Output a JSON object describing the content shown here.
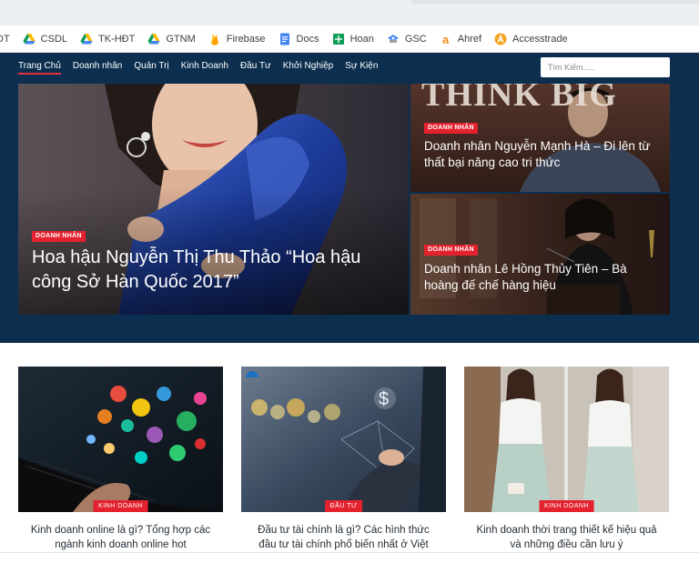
{
  "bookmarks": [
    {
      "label": "DT",
      "icon": "bookmark-icon"
    },
    {
      "label": "CSDL",
      "icon": "google-drive-icon"
    },
    {
      "label": "TK-HĐT",
      "icon": "google-drive-icon"
    },
    {
      "label": "GTNM",
      "icon": "google-drive-icon"
    },
    {
      "label": "Firebase",
      "icon": "firebase-icon"
    },
    {
      "label": "Docs",
      "icon": "google-docs-icon"
    },
    {
      "label": "Hoan",
      "icon": "google-sheets-icon"
    },
    {
      "label": "GSC",
      "icon": "search-console-icon"
    },
    {
      "label": "Ahref",
      "icon": "ahrefs-icon"
    },
    {
      "label": "Accesstrade",
      "icon": "accesstrade-icon"
    }
  ],
  "nav": {
    "items": [
      "Trang Chủ",
      "Doanh nhân",
      "Quản Trị",
      "Kinh Doanh",
      "Đầu Tư",
      "Khởi Nghiệp",
      "Sự Kiện"
    ],
    "search_placeholder": "Tìm Kiếm....."
  },
  "featured": {
    "main": {
      "badge": "DOANH NHÂN",
      "title": "Hoa hậu Nguyễn Thị Thu Thảo “Hoa hậu công Sở Hàn Quốc 2017”"
    },
    "side1": {
      "badge": "DOANH NHÂN",
      "title": "Doanh nhân Nguyễn Mạnh Hà – Đi lên từ thất bại nâng cao tri thức",
      "image_text": "THINK BIG"
    },
    "side2": {
      "badge": "DOANH NHÂN",
      "title": "Doanh nhân Lê Hồng Thủy Tiên – Bà hoàng đế chế hàng hiệu"
    }
  },
  "cards": [
    {
      "badge": "KINH DOANH",
      "title": "Kinh doanh online là gì? Tổng hợp các ngành kinh doanh online hot"
    },
    {
      "badge": "ĐẦU TƯ",
      "title": "Đầu tư tài chính là gì? Các hình thức đầu tư tài chính phổ biến nhất ở Việt"
    },
    {
      "badge": "KINH DOANH",
      "title": "Kinh doanh thời trang thiết kế hiệu quả và những điều cần lưu ý"
    }
  ],
  "colors": {
    "navbar": "#0d2f4f",
    "badge": "#e4222e",
    "active_underline": "#e3333f"
  }
}
